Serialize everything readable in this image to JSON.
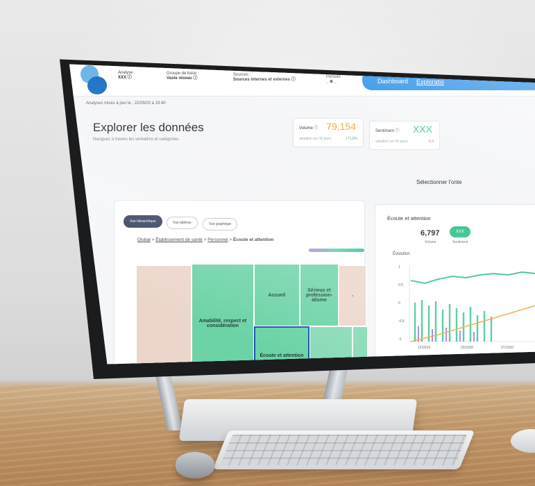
{
  "header": {
    "filters": [
      {
        "label": "Analyse :",
        "value": "XXX ⓘ"
      },
      {
        "label": "Groupe de base :",
        "value": "Vaste réseau ⓘ"
      },
      {
        "label": "Sources :",
        "value": "Sources internes et externes ⓘ"
      },
      {
        "label": "Période :",
        "value": "_ ⊕ _"
      }
    ],
    "tabs": [
      "Dashboard",
      "Exploratio"
    ]
  },
  "updated": "Analyses mises à jour le : 22/09/20 à 19:40",
  "page": {
    "title": "Explorer les données",
    "subtitle": "Naviguez à travers les verbatims et catégories."
  },
  "kpis": [
    {
      "label": "Volume ⓘ",
      "value": "79,154",
      "sub": "variation sur 30 jours",
      "change": "+71,5%",
      "color": "#f4a23b"
    },
    {
      "label": "Sentiment ⓘ",
      "value": "XXX",
      "sub": "variation sur 30 jours",
      "change": "-0,4",
      "color": "#3cc58e"
    }
  ],
  "select_context": "Sélectionner l'onte",
  "views": [
    "Vue hiérarchique",
    "Vue tableau",
    "Vue graphique"
  ],
  "breadcrumb": {
    "links": [
      "Global",
      "Établissement de santé",
      "Personnel"
    ],
    "current": "Écoute et attention"
  },
  "treemap": [
    {
      "label": "",
      "color": "peach"
    },
    {
      "label": "Amabilité, respect et considération",
      "color": "mint"
    },
    {
      "label": "Accueil",
      "color": "mint"
    },
    {
      "label": "Sérieux et profession- alisme",
      "color": "mint"
    },
    {
      "label": "-",
      "color": "peach"
    },
    {
      "label": "Écoute et attention",
      "color": "mint",
      "selected": true
    },
    {
      "label": "",
      "color": "mint2"
    },
    {
      "label": "",
      "color": "mint2"
    }
  ],
  "side": {
    "title": "Écoute et attention",
    "volume_value": "6,797",
    "volume_label": "Volume",
    "sentiment_badge": "XXX",
    "sentiment_label": "Sentiment",
    "evolution_label": "Évolution",
    "y_ticks": [
      "1",
      "0.5",
      "0",
      "-0.5",
      "-1"
    ],
    "x_ticks": [
      "12/2019",
      "03/2020",
      "07/2020"
    ]
  },
  "colors": {
    "accent": "#1a87e6",
    "mint": "#6cd3a6",
    "peach": "#ecd6cb",
    "orange": "#f4a23b"
  }
}
